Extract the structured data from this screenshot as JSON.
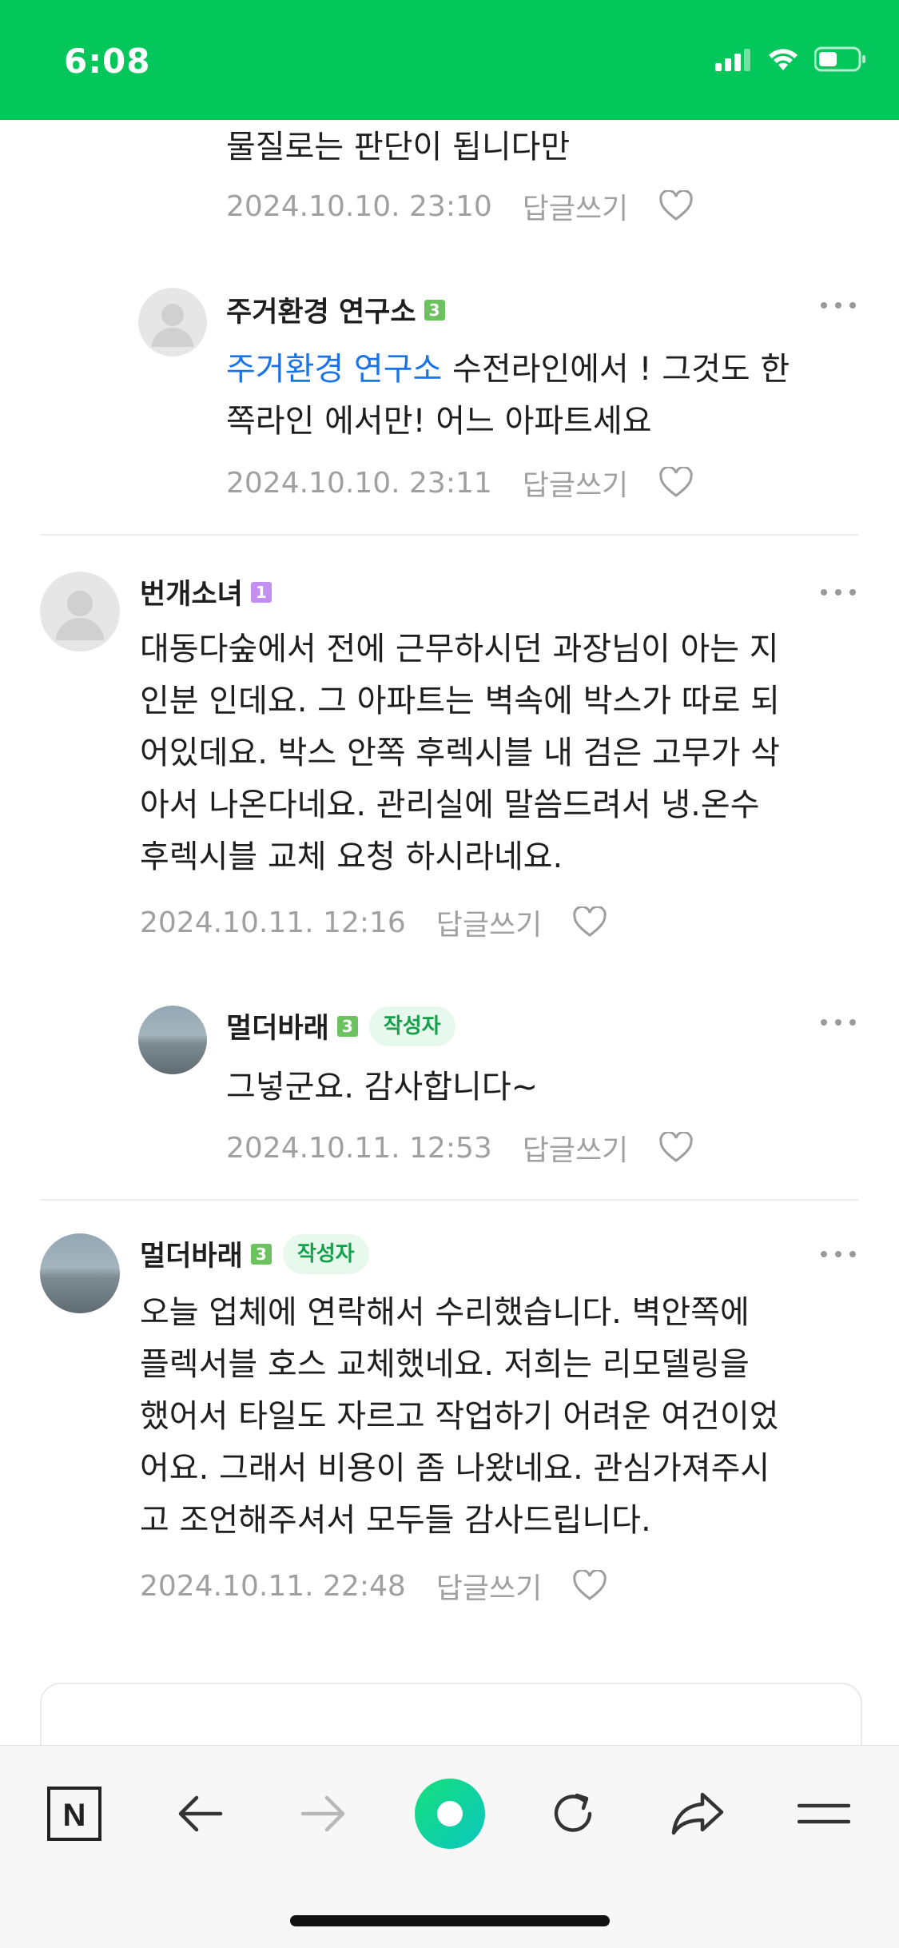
{
  "status_bar": {
    "time": "6:08"
  },
  "comments": [
    {
      "text_lines": [
        "물질로는 판단이 됩니다만"
      ],
      "date": "2024.10.10. 23:10",
      "reply_label": "답글쓰기"
    },
    {
      "author": "주거환경 연구소",
      "level": "3",
      "mention": "주거환경 연구소",
      "text_line1_rest": " 수전라인에서 ! 그것도 한",
      "text_line2": "쪽라인 에서만! 어느 아파트세요",
      "date": "2024.10.10. 23:11",
      "reply_label": "답글쓰기"
    },
    {
      "author": "번개소녀",
      "level": "1",
      "text_lines": [
        "대동다숲에서 전에 근무하시던 과장님이 아는 지",
        "인분 인데요. 그 아파트는 벽속에 박스가 따로 되",
        "어있데요. 박스 안쪽 후렉시블 내 검은 고무가 삭",
        "아서 나온다네요. 관리실에 말씀드려서 냉.온수",
        "후렉시블 교체 요청 하시라네요."
      ],
      "date": "2024.10.11. 12:16",
      "reply_label": "답글쓰기"
    },
    {
      "author": "멀더바래",
      "level": "3",
      "badge": "작성자",
      "text_lines": [
        "그넣군요. 감사합니다~"
      ],
      "date": "2024.10.11. 12:53",
      "reply_label": "답글쓰기"
    },
    {
      "author": "멀더바래",
      "level": "3",
      "badge": "작성자",
      "text_lines": [
        "오늘 업체에 연락해서 수리했습니다. 벽안쪽에",
        "플렉서블 호스 교체했네요. 저희는 리모델링을",
        "했어서 타일도 자르고 작업하기 어려운 여건이었",
        "어요. 그래서 비용이 좀 나왔네요. 관심가져주시",
        "고 조언해주셔서 모두들 감사드립니다."
      ],
      "date": "2024.10.11. 22:48",
      "reply_label": "답글쓰기"
    }
  ],
  "toolbar": {
    "logo": "N",
    "icons": [
      "naver-home-icon",
      "back-arrow-icon",
      "forward-arrow-icon",
      "green-dot-icon",
      "refresh-icon",
      "share-icon",
      "menu-icon"
    ]
  },
  "colors": {
    "brand": "#03c75a",
    "mention": "#1a73e8",
    "meta": "#a0a0a0",
    "badge_text": "#14a04b",
    "badge_bg": "#e7f8ec"
  }
}
